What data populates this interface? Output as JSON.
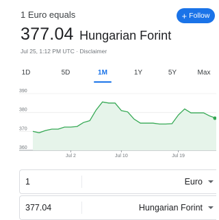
{
  "header": {
    "subtitle": "1 Euro equals",
    "follow_label": "Follow",
    "value": "377.04",
    "currency_name": "Hungarian Forint",
    "updated": "Jul 25, 1:12 PM UTC",
    "separator": "·",
    "disclaimer": "Disclaimer"
  },
  "tabs": [
    {
      "label": "1D",
      "active": false
    },
    {
      "label": "5D",
      "active": false
    },
    {
      "label": "1M",
      "active": true
    },
    {
      "label": "1Y",
      "active": false
    },
    {
      "label": "5Y",
      "active": false
    },
    {
      "label": "Max",
      "active": false
    }
  ],
  "chart_data": {
    "type": "area",
    "ylim": [
      360,
      390
    ],
    "y_ticks": [
      "390",
      "380",
      "370",
      "360"
    ],
    "y_tick_values": [
      390,
      380,
      370,
      360
    ],
    "x_ticks": [
      "Jul 2",
      "Jul 10",
      "Jul 19"
    ],
    "grid": true,
    "line_color": "#34a853",
    "fill_color": "#e6f4ea",
    "series": [
      {
        "values": [
          370.0,
          369.3,
          370.5,
          371.2,
          371.2,
          372.3,
          372.3,
          372.6,
          374.7,
          375.7,
          381.3,
          385.6,
          385.0,
          385.0,
          381.0,
          380.3,
          376.5,
          374.4,
          374.4,
          374.4,
          373.9,
          373.9,
          374.1,
          378.7,
          381.9,
          379.8,
          379.8,
          379.8,
          378.1,
          377.0
        ]
      }
    ]
  },
  "converter": {
    "from_amount": "1",
    "from_unit": "Euro",
    "to_amount": "377.04",
    "to_unit": "Hungarian Forint"
  },
  "colors": {
    "accent": "#1a73e8",
    "positive": "#34a853"
  }
}
